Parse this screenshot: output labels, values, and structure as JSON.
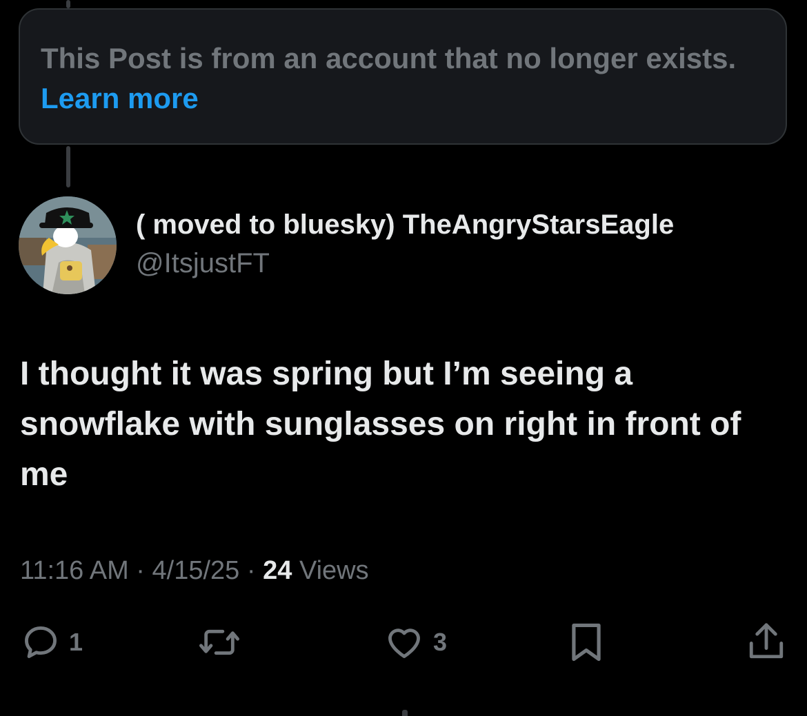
{
  "notice": {
    "text": "This Post is from an account that no longer exists.",
    "link_label": "Learn more"
  },
  "author": {
    "display_name": "( moved to bluesky) TheAngryStarsEagle",
    "handle": "@ItsjustFT",
    "avatar_icon": "eagle-mascot-avatar"
  },
  "post": {
    "text": "I thought it was spring but I’m seeing a snowflake with sunglasses on right in front of me"
  },
  "meta": {
    "time": "11:16 AM",
    "separator": "·",
    "date": "4/15/25",
    "views_count": "24",
    "views_label": "Views"
  },
  "actions": {
    "reply": {
      "icon": "reply-icon",
      "count": "1"
    },
    "repost": {
      "icon": "repost-icon"
    },
    "like": {
      "icon": "heart-icon",
      "count": "3"
    },
    "bookmark": {
      "icon": "bookmark-icon"
    },
    "share": {
      "icon": "share-icon"
    }
  },
  "colors": {
    "background": "#000000",
    "text_primary": "#e7e9ea",
    "text_secondary": "#71767b",
    "link": "#1d9bf0",
    "notice_bg": "#16181c"
  }
}
